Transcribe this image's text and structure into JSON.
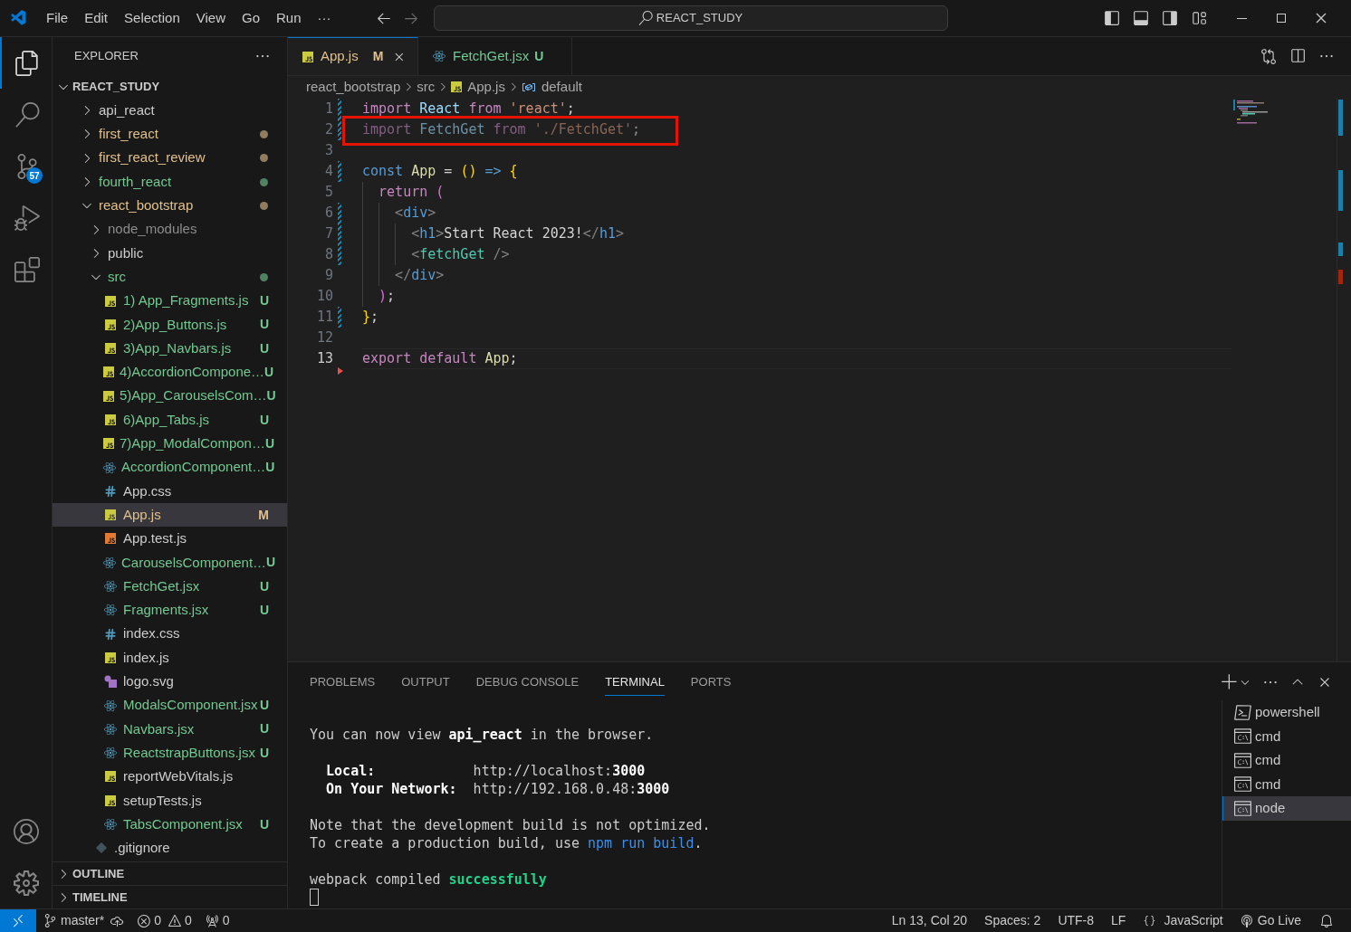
{
  "title_bar": {
    "menu": [
      "File",
      "Edit",
      "Selection",
      "View",
      "Go",
      "Run",
      "···"
    ],
    "command_center": "REACT_STUDY"
  },
  "activity_bar": {
    "items": [
      {
        "kind": "explorer",
        "selected": true
      },
      {
        "kind": "search",
        "selected": false
      },
      {
        "kind": "source_control",
        "selected": false,
        "badge": "57"
      },
      {
        "kind": "run_debug",
        "selected": false
      },
      {
        "kind": "extensions",
        "selected": false
      }
    ],
    "bottom": [
      {
        "kind": "accounts"
      },
      {
        "kind": "manage"
      }
    ]
  },
  "explorer": {
    "title": "EXPLORER",
    "root": {
      "label": "REACT_STUDY",
      "expanded": true
    },
    "tree": [
      {
        "name": "api_react",
        "kind": "folder",
        "color": "#cccccc",
        "expanded": false,
        "selected": false
      },
      {
        "name": "first_react",
        "kind": "folder",
        "color": "#e2c08d",
        "dot": true,
        "expanded": false,
        "selected": false
      },
      {
        "name": "first_react_review",
        "kind": "folder",
        "color": "#e2c08d",
        "dot": true,
        "expanded": false,
        "selected": false
      },
      {
        "name": "fourth_react",
        "kind": "folder",
        "color": "#73c991",
        "dot": true,
        "expanded": false,
        "selected": false
      },
      {
        "name": "react_bootstrap",
        "kind": "folder",
        "color": "#e2c08d",
        "dot": true,
        "expanded": true,
        "selected": false,
        "children": [
          {
            "name": "node_modules",
            "kind": "folder",
            "color": "#8c8c8c",
            "expanded": false,
            "selected": false
          },
          {
            "name": "public",
            "kind": "folder",
            "color": "#cccccc",
            "expanded": false,
            "selected": false
          },
          {
            "name": "src",
            "kind": "folder",
            "color": "#73c991",
            "dot": true,
            "expanded": true,
            "selected": false,
            "children": [
              {
                "name": "1) App_Fragments.js",
                "kind": "js",
                "color": "#73c991",
                "badge": "U",
                "selected": false
              },
              {
                "name": "2)App_Buttons.js",
                "kind": "js",
                "color": "#73c991",
                "badge": "U",
                "selected": false
              },
              {
                "name": "3)App_Navbars.js",
                "kind": "js",
                "color": "#73c991",
                "badge": "U",
                "selected": false
              },
              {
                "name": "4)AccordionCompone…",
                "kind": "js",
                "color": "#73c991",
                "badge": "U",
                "selected": false
              },
              {
                "name": "5)App_CarouselsCom…",
                "kind": "js",
                "color": "#73c991",
                "badge": "U",
                "selected": false
              },
              {
                "name": "6)App_Tabs.js",
                "kind": "js",
                "color": "#73c991",
                "badge": "U",
                "selected": false
              },
              {
                "name": "7)App_ModalCompon…",
                "kind": "js",
                "color": "#73c991",
                "badge": "U",
                "selected": false
              },
              {
                "name": "AccordionComponent…",
                "kind": "react",
                "color": "#73c991",
                "badge": "U",
                "selected": false
              },
              {
                "name": "App.css",
                "kind": "css",
                "color": "#cccccc",
                "selected": false
              },
              {
                "name": "App.js",
                "kind": "js",
                "color": "#e2c08d",
                "badge": "M",
                "selected": true
              },
              {
                "name": "App.test.js",
                "kind": "js_test",
                "color": "#cccccc",
                "selected": false
              },
              {
                "name": "CarouselsComponent…",
                "kind": "react",
                "color": "#73c991",
                "badge": "U",
                "selected": false
              },
              {
                "name": "FetchGet.jsx",
                "kind": "react",
                "color": "#73c991",
                "badge": "U",
                "selected": false
              },
              {
                "name": "Fragments.jsx",
                "kind": "react",
                "color": "#73c991",
                "badge": "U",
                "selected": false
              },
              {
                "name": "index.css",
                "kind": "css",
                "color": "#cccccc",
                "selected": false
              },
              {
                "name": "index.js",
                "kind": "js",
                "color": "#cccccc",
                "selected": false
              },
              {
                "name": "logo.svg",
                "kind": "svg",
                "color": "#cccccc",
                "selected": false
              },
              {
                "name": "ModalsComponent.jsx",
                "kind": "react",
                "color": "#73c991",
                "badge": "U",
                "selected": false
              },
              {
                "name": "Navbars.jsx",
                "kind": "react",
                "color": "#73c991",
                "badge": "U",
                "selected": false
              },
              {
                "name": "ReactstrapButtons.jsx",
                "kind": "react",
                "color": "#73c991",
                "badge": "U",
                "selected": false
              },
              {
                "name": "reportWebVitals.js",
                "kind": "js",
                "color": "#cccccc",
                "selected": false
              },
              {
                "name": "setupTests.js",
                "kind": "js",
                "color": "#cccccc",
                "selected": false
              },
              {
                "name": "TabsComponent.jsx",
                "kind": "react",
                "color": "#73c991",
                "badge": "U",
                "selected": false
              }
            ]
          },
          {
            "name": ".gitignore",
            "kind": "gitignore",
            "color": "#cccccc",
            "selected": false
          }
        ]
      }
    ],
    "sections": [
      {
        "label": "OUTLINE",
        "expanded": false
      },
      {
        "label": "TIMELINE",
        "expanded": false
      }
    ]
  },
  "tabs": [
    {
      "label": "App.js",
      "kind": "js",
      "color": "#e2c08d",
      "badge": "M",
      "selected": true
    },
    {
      "label": "FetchGet.jsx",
      "kind": "react",
      "color": "#73c991",
      "badge": "U",
      "selected": false
    }
  ],
  "breadcrumbs": [
    {
      "label": "react_bootstrap",
      "kind": "folder"
    },
    {
      "label": "src",
      "kind": "folder"
    },
    {
      "label": "App.js",
      "kind": "js"
    },
    {
      "label": "default",
      "kind": "symbol"
    }
  ],
  "code": [
    {
      "number": "1",
      "modified": true,
      "tokens": [
        {
          "t": "import ",
          "kind": "kw"
        },
        {
          "t": "React ",
          "kind": "var"
        },
        {
          "t": "from ",
          "kind": "kw"
        },
        {
          "t": "'react'",
          "kind": "str"
        },
        {
          "t": ";",
          "kind": "p"
        }
      ]
    },
    {
      "number": "2",
      "modified": true,
      "faded": true,
      "highlighted": true,
      "tokens": [
        {
          "t": "import ",
          "kind": "kw"
        },
        {
          "t": "FetchGet ",
          "kind": "var"
        },
        {
          "t": "from ",
          "kind": "kw"
        },
        {
          "t": "'./FetchGet'",
          "kind": "str"
        },
        {
          "t": ";",
          "kind": "p"
        }
      ]
    },
    {
      "number": "3",
      "modified": false
    },
    {
      "number": "4",
      "modified": true,
      "tokens": [
        {
          "t": "const ",
          "kind": "decl"
        },
        {
          "t": "App",
          "kind": "fn"
        },
        {
          "t": " = ",
          "kind": "p"
        },
        {
          "t": "() ",
          "kind": "b1"
        },
        {
          "t": "=> ",
          "kind": "decl"
        },
        {
          "t": "{",
          "kind": "b1"
        }
      ]
    },
    {
      "number": "5",
      "modified": false,
      "tokens": [
        {
          "t": "  return ",
          "kind": "kw"
        },
        {
          "t": "(",
          "kind": "b2"
        }
      ]
    },
    {
      "number": "6",
      "modified": true,
      "tokens": [
        {
          "t": "    <",
          "kind": "tagp"
        },
        {
          "t": "div",
          "kind": "tag"
        },
        {
          "t": ">",
          "kind": "tagp"
        }
      ]
    },
    {
      "number": "7",
      "modified": true,
      "tokens": [
        {
          "t": "      <",
          "kind": "tagp"
        },
        {
          "t": "h1",
          "kind": "tag"
        },
        {
          "t": ">",
          "kind": "tagp"
        },
        {
          "t": "Start React 2023!",
          "kind": "p"
        },
        {
          "t": "</",
          "kind": "tagp"
        },
        {
          "t": "h1",
          "kind": "tag"
        },
        {
          "t": ">",
          "kind": "tagp"
        }
      ]
    },
    {
      "number": "8",
      "modified": true,
      "tokens": [
        {
          "t": "      <",
          "kind": "tagp"
        },
        {
          "t": "fetchGet ",
          "kind": "comp"
        },
        {
          "t": "/>",
          "kind": "tagp"
        }
      ]
    },
    {
      "number": "9",
      "modified": false,
      "tokens": [
        {
          "t": "    </",
          "kind": "tagp"
        },
        {
          "t": "div",
          "kind": "tag"
        },
        {
          "t": ">",
          "kind": "tagp"
        }
      ]
    },
    {
      "number": "10",
      "modified": false,
      "tokens": [
        {
          "t": "  )",
          "kind": "b2"
        },
        {
          "t": ";",
          "kind": "p"
        }
      ]
    },
    {
      "number": "11",
      "modified": true,
      "tokens": [
        {
          "t": "}",
          "kind": "b1"
        },
        {
          "t": ";",
          "kind": "p"
        }
      ]
    },
    {
      "number": "12",
      "modified": false
    },
    {
      "number": "13",
      "modified": false,
      "deleted": true,
      "current": true,
      "tokens": [
        {
          "t": "export ",
          "kind": "kw"
        },
        {
          "t": "default ",
          "kind": "kw"
        },
        {
          "t": "App",
          "kind": "fn"
        },
        {
          "t": ";",
          "kind": "p"
        }
      ]
    }
  ],
  "panel": {
    "tabs": [
      {
        "label": "PROBLEMS",
        "selected": false
      },
      {
        "label": "OUTPUT",
        "selected": false
      },
      {
        "label": "DEBUG CONSOLE",
        "selected": false
      },
      {
        "label": "TERMINAL",
        "selected": true
      },
      {
        "label": "PORTS",
        "selected": false
      }
    ],
    "terminal": {
      "blocks": [
        [
          [
            {
              "t": "You can now view ",
              "kind": "text"
            },
            {
              "t": "api_react",
              "kind": "bold"
            },
            {
              "t": " in the browser.",
              "kind": "text"
            }
          ]
        ],
        [
          [
            {
              "t": "  Local:",
              "kind": "bold"
            },
            {
              "t": "            http://localhost:",
              "kind": "text"
            },
            {
              "t": "3000",
              "kind": "bold"
            }
          ],
          [
            {
              "t": "  On Your Network:",
              "kind": "bold"
            },
            {
              "t": "  http://192.168.0.48:",
              "kind": "text"
            },
            {
              "t": "3000",
              "kind": "bold"
            }
          ]
        ],
        [
          [
            {
              "t": "Note that the development build is not optimized.",
              "kind": "text"
            }
          ],
          [
            {
              "t": "To create a production build, use ",
              "kind": "text"
            },
            {
              "t": "npm run build",
              "kind": "link"
            },
            {
              "t": ".",
              "kind": "text"
            }
          ]
        ],
        [
          [
            {
              "t": "webpack compiled ",
              "kind": "text"
            },
            {
              "t": "successfully",
              "kind": "success"
            }
          ]
        ]
      ],
      "cursor": true
    },
    "sessions": [
      {
        "name": "powershell",
        "kind": "powershell",
        "selected": false
      },
      {
        "name": "cmd",
        "kind": "cmd",
        "selected": false
      },
      {
        "name": "cmd",
        "kind": "cmd",
        "selected": false
      },
      {
        "name": "cmd",
        "kind": "cmd",
        "selected": false
      },
      {
        "name": "node",
        "kind": "cmd",
        "selected": true
      }
    ]
  },
  "status_bar": {
    "branch": "master*",
    "errors": "0",
    "warnings": "0",
    "ports": "0",
    "right": [
      {
        "kind": "text",
        "label": "Ln 13, Col 20"
      },
      {
        "kind": "text",
        "label": "Spaces: 2"
      },
      {
        "kind": "text",
        "label": "UTF-8"
      },
      {
        "kind": "text",
        "label": "LF"
      },
      {
        "kind": "language",
        "label": "JavaScript"
      },
      {
        "kind": "live",
        "label": "Go Live"
      },
      {
        "kind": "bell"
      }
    ]
  }
}
